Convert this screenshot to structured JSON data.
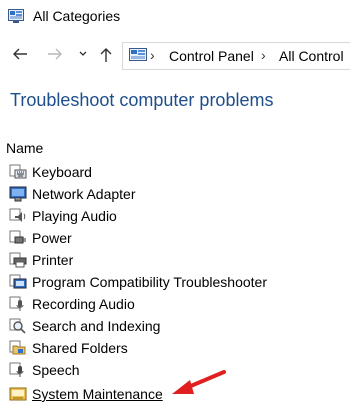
{
  "window": {
    "title": "All Categories",
    "icon": "control-panel-icon"
  },
  "nav": {
    "back_icon": "arrow-left-icon",
    "forward_icon": "arrow-right-icon",
    "recent_icon": "chevron-down-icon",
    "up_icon": "arrow-up-icon"
  },
  "address": {
    "breadcrumbs": [
      "Control Panel",
      "All Control"
    ]
  },
  "page": {
    "title": "Troubleshoot computer problems",
    "column_header": "Name"
  },
  "items": [
    {
      "label": "Keyboard",
      "icon": "keyboard-icon"
    },
    {
      "label": "Network Adapter",
      "icon": "network-adapter-icon"
    },
    {
      "label": "Playing Audio",
      "icon": "speaker-icon"
    },
    {
      "label": "Power",
      "icon": "power-icon"
    },
    {
      "label": "Printer",
      "icon": "printer-icon"
    },
    {
      "label": "Program Compatibility Troubleshooter",
      "icon": "compatibility-icon"
    },
    {
      "label": "Recording Audio",
      "icon": "microphone-icon"
    },
    {
      "label": "Search and Indexing",
      "icon": "search-icon"
    },
    {
      "label": "Shared Folders",
      "icon": "shared-folder-icon"
    },
    {
      "label": "Speech",
      "icon": "speech-icon"
    },
    {
      "label": "System Maintenance",
      "icon": "system-maintenance-icon",
      "highlighted": true
    }
  ],
  "colors": {
    "title_blue": "#1e4e8c",
    "annotation_red": "#e02020"
  }
}
